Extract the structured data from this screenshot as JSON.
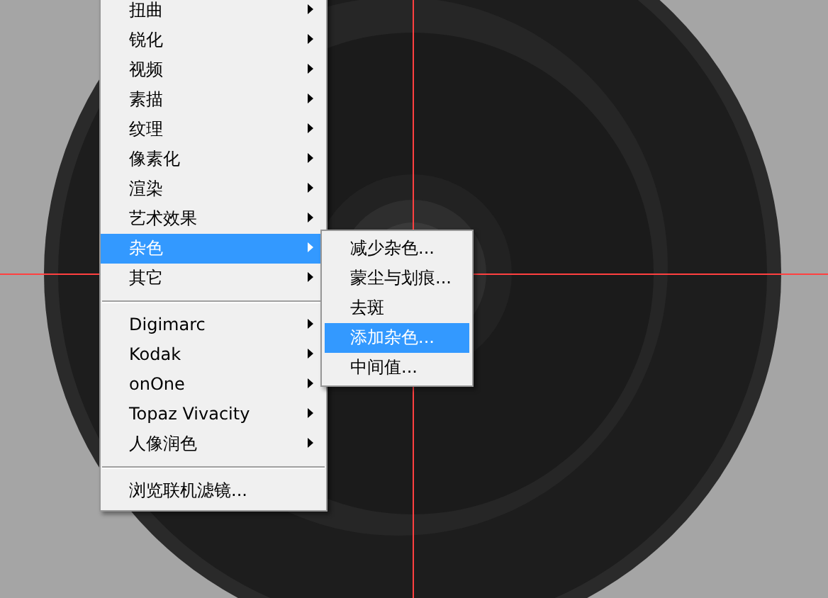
{
  "menu": {
    "groups": [
      [
        {
          "label": "扭曲",
          "has_submenu": true,
          "selected": false
        },
        {
          "label": "锐化",
          "has_submenu": true,
          "selected": false
        },
        {
          "label": "视频",
          "has_submenu": true,
          "selected": false
        },
        {
          "label": "素描",
          "has_submenu": true,
          "selected": false
        },
        {
          "label": "纹理",
          "has_submenu": true,
          "selected": false
        },
        {
          "label": "像素化",
          "has_submenu": true,
          "selected": false
        },
        {
          "label": "渲染",
          "has_submenu": true,
          "selected": false
        },
        {
          "label": "艺术效果",
          "has_submenu": true,
          "selected": false
        },
        {
          "label": "杂色",
          "has_submenu": true,
          "selected": true
        },
        {
          "label": "其它",
          "has_submenu": true,
          "selected": false
        }
      ],
      [
        {
          "label": "Digimarc",
          "has_submenu": true,
          "selected": false
        },
        {
          "label": "Kodak",
          "has_submenu": true,
          "selected": false
        },
        {
          "label": "onOne",
          "has_submenu": true,
          "selected": false
        },
        {
          "label": "Topaz Vivacity",
          "has_submenu": true,
          "selected": false
        },
        {
          "label": "人像润色",
          "has_submenu": true,
          "selected": false
        }
      ],
      [
        {
          "label": "浏览联机滤镜...",
          "has_submenu": false,
          "selected": false
        }
      ]
    ]
  },
  "submenu": {
    "items": [
      {
        "label": "减少杂色...",
        "selected": false
      },
      {
        "label": "蒙尘与划痕...",
        "selected": false
      },
      {
        "label": "去斑",
        "selected": false
      },
      {
        "label": "添加杂色...",
        "selected": true
      },
      {
        "label": "中间值...",
        "selected": false
      }
    ]
  }
}
